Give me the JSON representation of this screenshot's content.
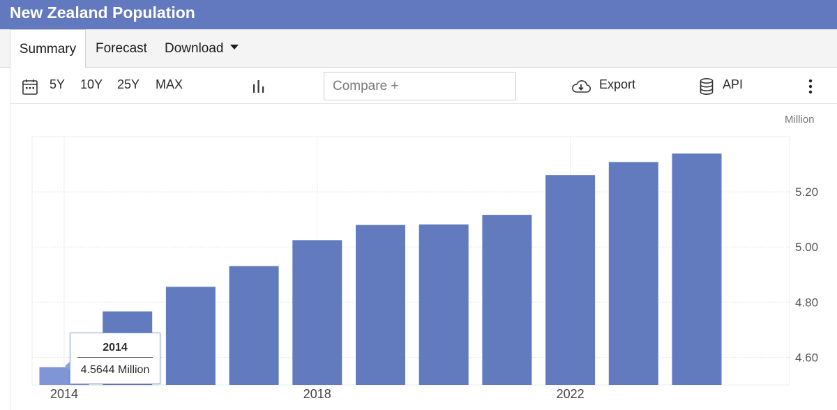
{
  "header": {
    "title": "New Zealand Population"
  },
  "tabs": [
    {
      "label": "Summary"
    },
    {
      "label": "Forecast"
    },
    {
      "label": "Download"
    }
  ],
  "toolbar": {
    "ranges": [
      "5Y",
      "10Y",
      "25Y",
      "MAX"
    ],
    "compare_placeholder": "Compare +",
    "export_label": "Export",
    "api_label": "API"
  },
  "icons": {
    "calendar": "calendar-icon",
    "chart_type": "bar-chart-icon",
    "export": "cloud-download-icon",
    "api": "database-icon",
    "more": "more-vertical-icon"
  },
  "colors": {
    "accent": "#6279bf",
    "bar": "#627bbf",
    "bar_highlight": "#7f95d6"
  },
  "chart_data": {
    "type": "bar",
    "unit": "Million",
    "categories": [
      "2014",
      "2015",
      "2016",
      "2017",
      "2018",
      "2019",
      "2020",
      "2021",
      "2022",
      "2023",
      "2024"
    ],
    "values": [
      4.5644,
      4.7665,
      4.8557,
      4.9307,
      5.0249,
      5.0798,
      5.0818,
      5.1166,
      5.2606,
      5.3081,
      5.3387
    ],
    "x_tick_labels": [
      "2014",
      "2018",
      "2022"
    ],
    "y_tick_labels": [
      "4.60",
      "4.80",
      "5.00",
      "5.20"
    ],
    "ylim": [
      4.5,
      5.4
    ],
    "grid": true,
    "y_axis_position": "right",
    "tooltip": {
      "category": "2014",
      "value_text": "4.5644 Million"
    }
  }
}
